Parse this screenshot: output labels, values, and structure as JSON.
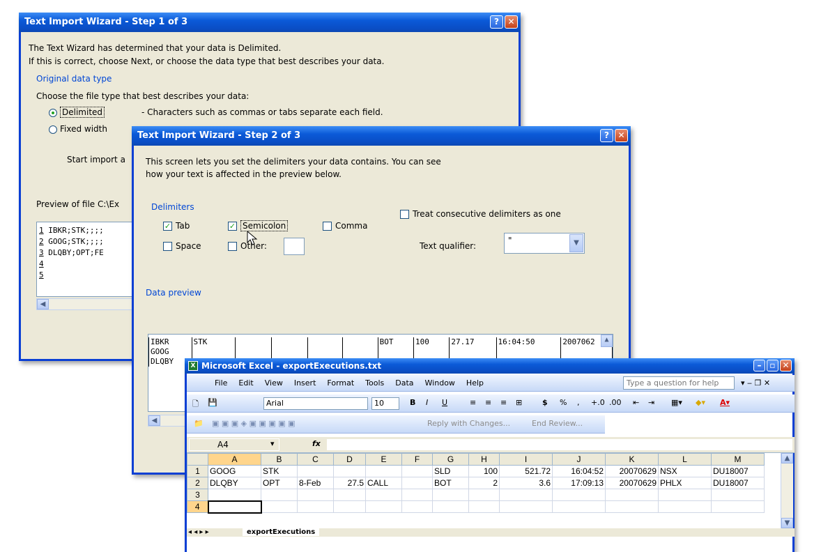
{
  "step1": {
    "title": "Text Import Wizard - Step 1 of 3",
    "line1": "The Text Wizard has determined that your data is Delimited.",
    "line2": "If this is correct, choose Next, or choose the data type that best describes your data.",
    "group": "Original data type",
    "choose": "Choose the file type that best describes your data:",
    "opt_delimited": "Delimited",
    "opt_delimited_desc": "- Characters such as commas or tabs separate each field.",
    "opt_fixed": "Fixed width",
    "start_import": "Start import a",
    "preview": "Preview of file C:\\Ex",
    "preview_rows": [
      {
        "n": "1",
        "text": "IBKR;STK;;;;"
      },
      {
        "n": "2",
        "text": "GOOG;STK;;;;"
      },
      {
        "n": "3",
        "text": "DLQBY;OPT;FE"
      },
      {
        "n": "4",
        "text": ""
      },
      {
        "n": "5",
        "text": ""
      }
    ]
  },
  "step2": {
    "title": "Text Import Wizard - Step 2 of 3",
    "intro1": "This screen lets you set the delimiters your data contains.  You can see",
    "intro2": "how your text is affected in the preview below.",
    "delimiters": "Delimiters",
    "tab": "Tab",
    "semicolon": "Semicolon",
    "comma": "Comma",
    "space": "Space",
    "other": "Other:",
    "treat_consecutive": "Treat consecutive delimiters as one",
    "text_qualifier": "Text qualifier:",
    "qualifier_value": "\"",
    "data_preview": "Data preview",
    "preview_rows": [
      [
        "IBKR",
        "STK",
        "",
        "",
        "",
        "",
        "BOT",
        "100",
        "27.17",
        "16:04:50",
        "2007062"
      ],
      [
        "GOOG",
        "",
        "",
        "",
        "",
        "",
        "",
        "",
        "",
        "",
        ""
      ],
      [
        "DLQBY",
        "",
        "",
        "",
        "",
        "",
        "",
        "",
        "",
        "",
        ""
      ]
    ]
  },
  "excel": {
    "title": "Microsoft Excel - exportExecutions.txt",
    "menu": [
      "File",
      "Edit",
      "View",
      "Insert",
      "Format",
      "Tools",
      "Data",
      "Window",
      "Help"
    ],
    "help_placeholder": "Type a question for help",
    "font": "Arial",
    "font_size": "10",
    "reply": "Reply with Changes...",
    "end_review": "End Review...",
    "name_box": "A4",
    "fx": "fx",
    "columns": [
      "A",
      "B",
      "C",
      "D",
      "E",
      "F",
      "G",
      "H",
      "I",
      "J",
      "K",
      "L",
      "M"
    ],
    "rows": [
      {
        "n": "1",
        "cells": [
          "GOOG",
          "STK",
          "",
          "",
          "",
          "",
          "SLD",
          "100",
          "521.72",
          "16:04:52",
          "20070629",
          "NSX",
          "DU18007"
        ]
      },
      {
        "n": "2",
        "cells": [
          "DLQBY",
          "OPT",
          "8-Feb",
          "27.5",
          "CALL",
          "",
          "BOT",
          "2",
          "3.6",
          "17:09:13",
          "20070629",
          "PHLX",
          "DU18007"
        ]
      },
      {
        "n": "3",
        "cells": [
          "",
          "",
          "",
          "",
          "",
          "",
          "",
          "",
          "",
          "",
          "",
          "",
          ""
        ]
      },
      {
        "n": "4",
        "cells": [
          "",
          "",
          "",
          "",
          "",
          "",
          "",
          "",
          "",
          "",
          "",
          "",
          ""
        ]
      }
    ],
    "sheet_tab": "exportExecutions"
  }
}
